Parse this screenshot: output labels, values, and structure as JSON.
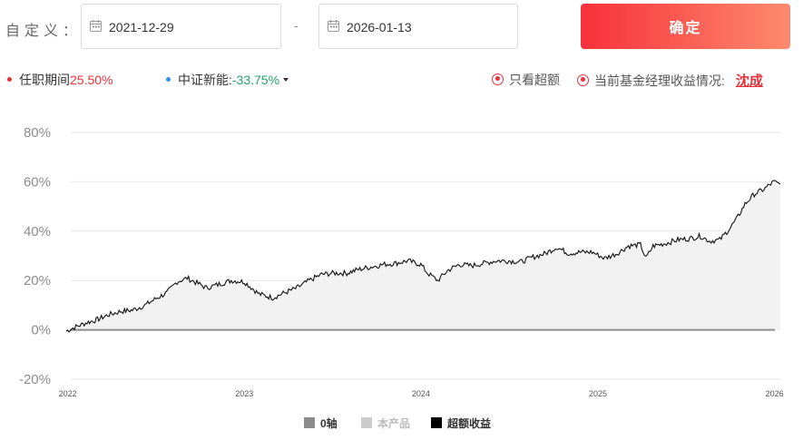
{
  "filter": {
    "label": "自定义：",
    "start_date": "2021-12-29",
    "end_date": "2026-01-13",
    "separator": "-",
    "confirm_label": "确定"
  },
  "summary": {
    "tenure_label": "任职期间",
    "tenure_value": "25.50%",
    "benchmark_label": "中证新能:",
    "benchmark_value": "-33.75%",
    "excess_only_label": "只看超额",
    "manager_label": "当前基金经理收益情况:",
    "manager_name": "沈成"
  },
  "colors": {
    "accent_red": "#e8313a",
    "benchmark_blue": "#2e8ff0",
    "positive_green": "#23a36b",
    "zero_axis": "#8c8c8c",
    "product_area": "#cccccc",
    "excess_line": "#000000"
  },
  "chart_data": {
    "type": "area",
    "title": "",
    "xlabel": "",
    "ylabel": "",
    "ylim": [
      -20,
      80
    ],
    "y_ticks": [
      -20,
      0,
      20,
      40,
      60,
      80
    ],
    "y_tick_labels": [
      "-20%",
      "0%",
      "20%",
      "40%",
      "60%",
      "80%"
    ],
    "x_range": [
      "2021-12-29",
      "2026-01-13"
    ],
    "x_ticks": [
      "2022-01-01",
      "2023-01-01",
      "2024-01-01",
      "2025-01-01",
      "2026-01-01"
    ],
    "x_tick_labels": [
      "2022",
      "2023",
      "2024",
      "2025",
      "2026"
    ],
    "grid": true,
    "legend_position": "bottom",
    "legend": [
      "0轴",
      "本产品",
      "超额收益"
    ],
    "series": [
      {
        "name": "超额收益",
        "x": [
          "2021-12-29",
          "2022-01-15",
          "2022-02-10",
          "2022-03-01",
          "2022-03-25",
          "2022-04-20",
          "2022-05-15",
          "2022-06-10",
          "2022-07-05",
          "2022-07-25",
          "2022-08-15",
          "2022-09-05",
          "2022-09-25",
          "2022-10-15",
          "2022-11-10",
          "2022-12-05",
          "2023-01-01",
          "2023-02-01",
          "2023-03-01",
          "2023-03-25",
          "2023-04-20",
          "2023-05-15",
          "2023-06-10",
          "2023-07-05",
          "2023-08-01",
          "2023-08-25",
          "2023-09-20",
          "2023-10-15",
          "2023-11-10",
          "2023-12-05",
          "2024-01-01",
          "2024-01-15",
          "2024-02-05",
          "2024-02-25",
          "2024-03-20",
          "2024-04-15",
          "2024-05-10",
          "2024-06-05",
          "2024-07-01",
          "2024-07-25",
          "2024-08-20",
          "2024-09-15",
          "2024-10-08",
          "2024-11-01",
          "2024-11-25",
          "2024-12-20",
          "2025-01-15",
          "2025-02-10",
          "2025-03-05",
          "2025-03-30",
          "2025-04-10",
          "2025-04-25",
          "2025-05-20",
          "2025-06-15",
          "2025-07-10",
          "2025-08-01",
          "2025-08-20",
          "2025-09-10",
          "2025-09-30",
          "2025-10-15",
          "2025-11-01",
          "2025-11-20",
          "2025-12-10",
          "2025-12-30",
          "2026-01-13"
        ],
        "values": [
          -0.5,
          1.0,
          3.0,
          4.0,
          6.0,
          7.5,
          8.0,
          10.0,
          13.0,
          15.0,
          19.5,
          21.0,
          19.0,
          17.0,
          18.5,
          20.0,
          19.5,
          14.5,
          13.0,
          15.0,
          17.0,
          20.0,
          22.5,
          23.0,
          23.0,
          24.5,
          25.5,
          26.5,
          27.0,
          28.0,
          26.5,
          23.0,
          20.0,
          24.0,
          26.5,
          26.0,
          27.0,
          28.0,
          28.0,
          27.5,
          29.5,
          31.0,
          33.5,
          31.0,
          31.5,
          31.5,
          29.0,
          31.0,
          34.0,
          34.5,
          29.0,
          34.0,
          35.0,
          36.5,
          37.0,
          38.0,
          36.0,
          36.5,
          41.0,
          45.0,
          51.0,
          55.0,
          57.0,
          60.0,
          59.0
        ]
      },
      {
        "name": "本产品",
        "style": "light filled area under the excess curve"
      },
      {
        "name": "0轴",
        "values": [
          0,
          0
        ]
      }
    ]
  }
}
